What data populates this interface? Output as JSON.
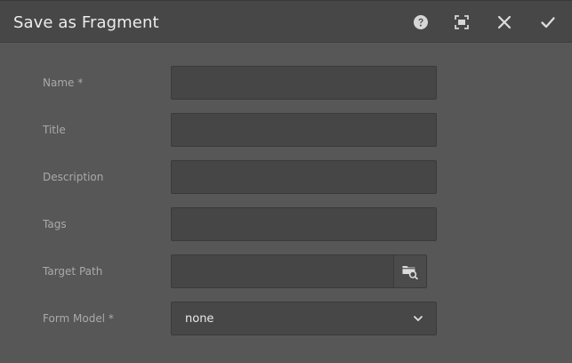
{
  "dialog": {
    "title": "Save as Fragment",
    "actions": {
      "help": "help",
      "fullscreen": "fullscreen",
      "close": "close",
      "done": "done"
    }
  },
  "form": {
    "name": {
      "label": "Name *",
      "value": "",
      "placeholder": ""
    },
    "title": {
      "label": "Title",
      "value": "",
      "placeholder": ""
    },
    "description": {
      "label": "Description",
      "value": "",
      "placeholder": ""
    },
    "tags": {
      "label": "Tags",
      "value": "",
      "placeholder": ""
    },
    "target_path": {
      "label": "Target Path",
      "value": "",
      "placeholder": ""
    },
    "form_model": {
      "label": "Form Model *",
      "selected": "none"
    }
  },
  "colors": {
    "background": "#575757",
    "titlebar": "#474747",
    "field": "#464646",
    "label_text": "#a9a9a9",
    "title_text": "#ececec"
  }
}
